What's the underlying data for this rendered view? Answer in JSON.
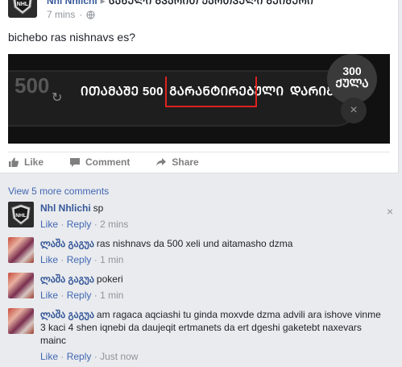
{
  "post": {
    "author": "Nhl Nhlichi",
    "target": "ᲡᲐᲮᲔᲚᲘ ᲒᲕᲐᲠᲘᲗ ᲥᲐᲠᲗᲕᲔᲚᲘ ᲒᲔᲘᲛᲔᲠᲘ",
    "time": "7 mins",
    "separator": "·",
    "text": "bichebo ras nishnavs es?"
  },
  "image": {
    "left_number": "500",
    "prize_prefix": "ᲘᲗᲐᲛᲐᲨᲔ 500 ",
    "prize_boxed": "ᲒᲐᲠᲐᲜᲢᲘᲠᲔᲑᲣᲚᲘ",
    "prize_suffix": " ᲓᲐᲠᲘᲒᲔᲑᲐ",
    "badge_number": "300",
    "badge_word": "ᲥᲣᲚᲐ",
    "close": "×"
  },
  "actions": {
    "like": "Like",
    "comment": "Comment",
    "share": "Share"
  },
  "comments_section": {
    "view_more": "View 5 more comments",
    "comments": [
      {
        "name": "Nhl Nhlichi",
        "text": "sp",
        "like": "Like",
        "reply": "Reply",
        "time": "2 mins",
        "sep": "·"
      },
      {
        "name": "ლაშა გაგუა",
        "text": "ras nishnavs da 500 xeli und aitamasho dzma",
        "like": "Like",
        "reply": "Reply",
        "time": "1 min",
        "sep": "·"
      },
      {
        "name": "ლაშა გაგუა",
        "text": "pokeri",
        "like": "Like",
        "reply": "Reply",
        "time": "1 min",
        "sep": "·"
      },
      {
        "name": "ლაშა გაგუა",
        "text": "am ragaca aqciashi tu ginda moxvde dzma advili ara ishove vinme 3 kaci 4 shen iqnebi da daujeqit ertmanets da ert dgeshi gaketebt naxevars mainc",
        "like": "Like",
        "reply": "Reply",
        "time": "Just now",
        "sep": "·"
      }
    ],
    "close": "×"
  },
  "colors": {
    "link": "#365899",
    "meta": "#90949c",
    "highlight_box": "#e02020"
  }
}
